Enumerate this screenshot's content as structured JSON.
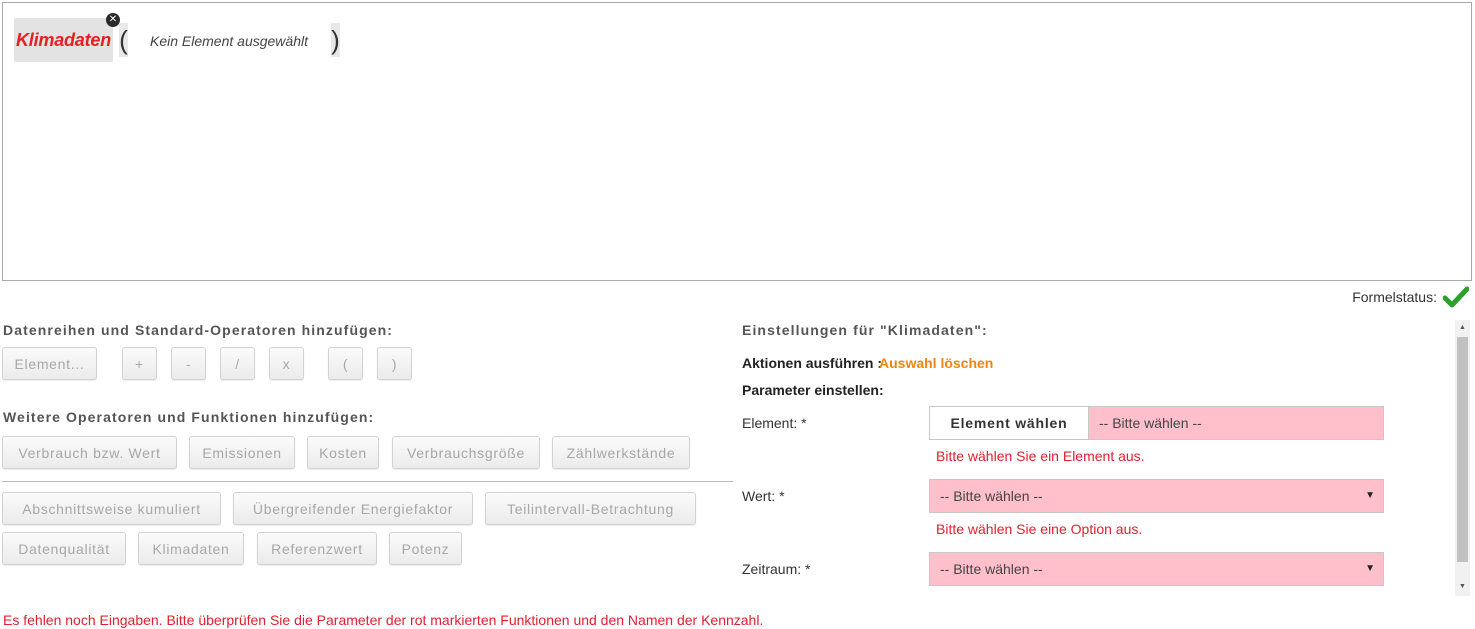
{
  "formula": {
    "function_name": "Klimadaten",
    "paren_open": "(",
    "paren_close": ")",
    "argument_placeholder": "Kein Element ausgewählt",
    "remove_symbol": "✕"
  },
  "status": {
    "label": "Formelstatus:",
    "state_icon": "check-icon",
    "state_color": "#2ca02c"
  },
  "left": {
    "standard_title": "Datenreihen und Standard-Operatoren hinzufügen:",
    "standard_buttons": [
      "Element...",
      "+",
      "-",
      "/",
      "x",
      "(",
      ")"
    ],
    "further_title": "Weitere Operatoren und Funktionen hinzufügen:",
    "function_row1": [
      "Verbrauch bzw. Wert",
      "Emissionen",
      "Kosten",
      "Verbrauchsgröße",
      "Zählwerkstände"
    ],
    "function_row2": [
      "Abschnittsweise kumuliert",
      "Übergreifender Energiefaktor",
      "Teilintervall-Betrachtung"
    ],
    "function_row3": [
      "Datenqualität",
      "Klimadaten",
      "Referenzwert",
      "Potenz"
    ]
  },
  "right": {
    "title": "Einstellungen für \"Klimadaten\":",
    "actions_label": "Aktionen ausführen :",
    "actions_link": "Auswahl löschen",
    "params_label": "Parameter einstellen:",
    "element_label": "Element: *",
    "element_button": "Element wählen",
    "element_value": "-- Bitte wählen --",
    "element_error": "Bitte wählen Sie ein Element aus.",
    "wert_label": "Wert: *",
    "wert_value": "-- Bitte wählen --",
    "wert_error": "Bitte wählen Sie eine Option aus.",
    "zeitraum_label": "Zeitraum: *",
    "zeitraum_value": "-- Bitte wählen --",
    "invalid_color": "#ffc0cb"
  },
  "bottom_error": "Es fehlen noch Eingaben. Bitte überprüfen Sie die Parameter der rot markierten Funktionen und den Namen der Kennzahl."
}
